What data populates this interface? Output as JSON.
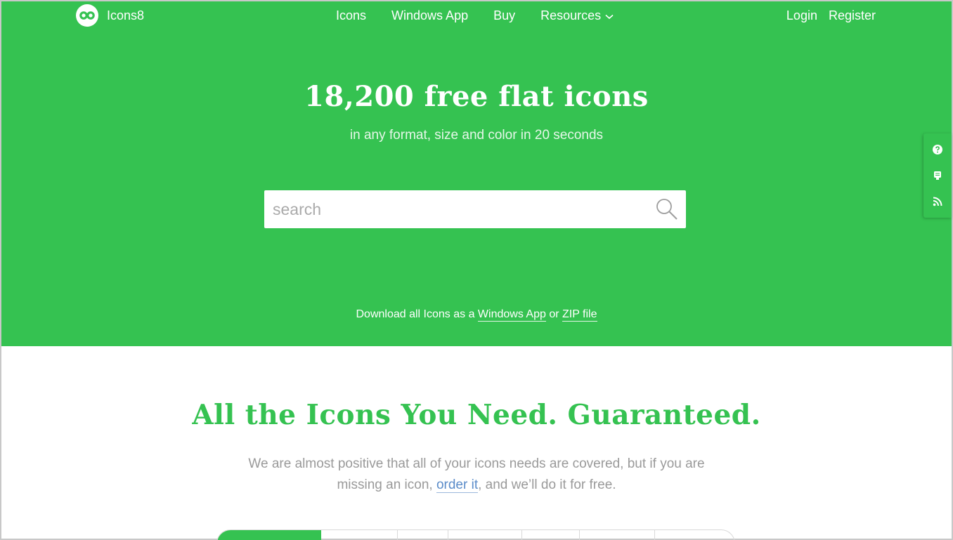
{
  "brand": {
    "name": "Icons8",
    "accent_color": "#35c251"
  },
  "nav": {
    "items": [
      {
        "label": "Icons"
      },
      {
        "label": "Windows App"
      },
      {
        "label": "Buy"
      },
      {
        "label": "Resources",
        "icon": "chevron-down-icon"
      }
    ],
    "login": "Login",
    "register": "Register"
  },
  "hero": {
    "title": "18,200 free flat icons",
    "subtitle": "in any format, size and color in 20 seconds",
    "search": {
      "placeholder": "search",
      "value": "",
      "icon": "search-icon"
    },
    "download": {
      "prefix": "Download all Icons as a",
      "app_link": "Windows App",
      "or": "or",
      "zip_link": "ZIP file"
    }
  },
  "side_tools": [
    {
      "icon": "help-icon"
    },
    {
      "icon": "feedback-icon"
    },
    {
      "icon": "rss-icon"
    }
  ],
  "section": {
    "title": "All the Icons You Need. Guaranteed.",
    "text_before": "We are almost positive that all of your icons needs are covered, but if you are missing an icon,",
    "link": "order it",
    "text_after": ", and we’ll do it for free."
  }
}
